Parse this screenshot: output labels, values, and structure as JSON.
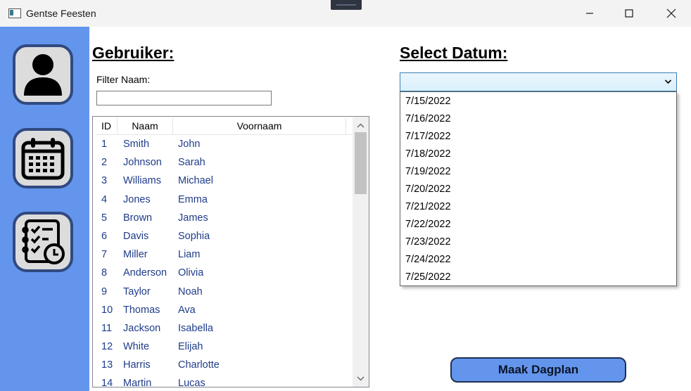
{
  "window": {
    "title": "Gentse Feesten"
  },
  "sidebar": {
    "items": [
      {
        "icon": "user-icon"
      },
      {
        "icon": "calendar-icon"
      },
      {
        "icon": "checklist-clock-icon"
      }
    ],
    "color": "#6495ed"
  },
  "user_section": {
    "heading": "Gebruiker:",
    "filter_label": "Filter Naam:",
    "filter_value": "",
    "columns": [
      "ID",
      "Naam",
      "Voornaam"
    ],
    "rows": [
      {
        "id": "1",
        "naam": "Smith",
        "voornaam": "John"
      },
      {
        "id": "2",
        "naam": "Johnson",
        "voornaam": "Sarah"
      },
      {
        "id": "3",
        "naam": "Williams",
        "voornaam": "Michael"
      },
      {
        "id": "4",
        "naam": "Jones",
        "voornaam": "Emma"
      },
      {
        "id": "5",
        "naam": "Brown",
        "voornaam": "James"
      },
      {
        "id": "6",
        "naam": "Davis",
        "voornaam": "Sophia"
      },
      {
        "id": "7",
        "naam": "Miller",
        "voornaam": "Liam"
      },
      {
        "id": "8",
        "naam": "Anderson",
        "voornaam": "Olivia"
      },
      {
        "id": "9",
        "naam": "Taylor",
        "voornaam": "Noah"
      },
      {
        "id": "10",
        "naam": "Thomas",
        "voornaam": "Ava"
      },
      {
        "id": "11",
        "naam": "Jackson",
        "voornaam": "Isabella"
      },
      {
        "id": "12",
        "naam": "White",
        "voornaam": "Elijah"
      },
      {
        "id": "13",
        "naam": "Harris",
        "voornaam": "Charlotte"
      },
      {
        "id": "14",
        "naam": "Martin",
        "voornaam": "Lucas"
      }
    ]
  },
  "date_section": {
    "heading": "Select Datum:",
    "selected": "",
    "options": [
      "7/15/2022",
      "7/16/2022",
      "7/17/2022",
      "7/18/2022",
      "7/19/2022",
      "7/20/2022",
      "7/21/2022",
      "7/22/2022",
      "7/23/2022",
      "7/24/2022",
      "7/25/2022"
    ]
  },
  "action_button": {
    "label": "Maak Dagplan"
  }
}
